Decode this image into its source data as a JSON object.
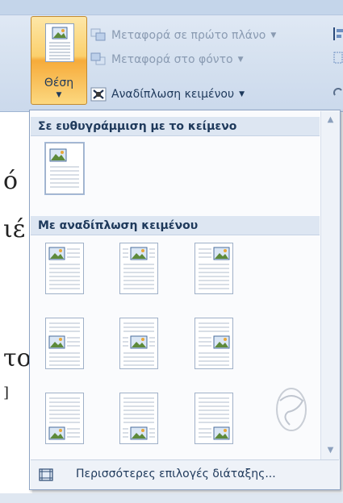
{
  "ribbon": {
    "position_button_label": "Θέση",
    "bring_to_front": "Μεταφορά σε πρώτο πλάνο",
    "send_to_back": "Μεταφορά στο φόντο",
    "text_wrapping": "Αναδίπλωση κειμένου"
  },
  "gallery": {
    "inline_header": "Σε ευθυγράμμιση με το κείμενο",
    "wrap_header": "Με αναδίπλωση κειμένου",
    "more_options": "Περισσότερες επιλογές διάταξης..."
  },
  "document": {
    "glyph1": "ό",
    "glyph2": "ιέ",
    "glyph3": "το",
    "glyph4": "]"
  },
  "icons": {
    "position": "position-icon",
    "bring_front": "bring-to-front-icon",
    "send_back": "send-to-back-icon",
    "wrap": "text-wrapping-icon",
    "layout": "layout-options-icon"
  }
}
